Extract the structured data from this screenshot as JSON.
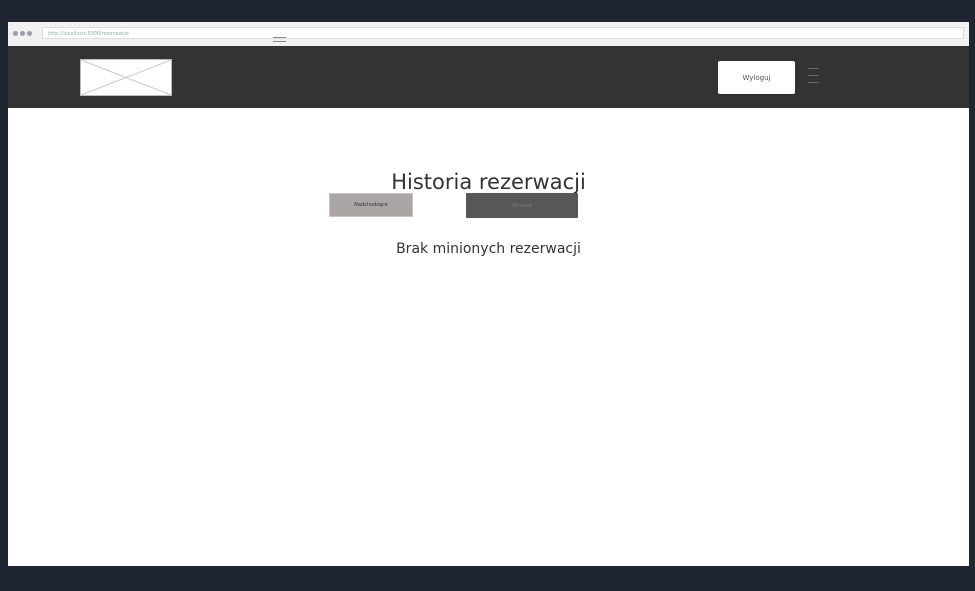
{
  "browser": {
    "url": "http://localhost:5000/rezerwacje"
  },
  "header": {
    "logout_label": "Wyloguj"
  },
  "main": {
    "title": "Historia rezerwacji",
    "tabs": [
      {
        "label": "Nadchodzące",
        "active": false
      },
      {
        "label": "Minione",
        "active": true
      }
    ],
    "empty_message": "Brak minionych rezerwacji"
  },
  "colors": {
    "background_frame": "#1f2632",
    "top_bar": "#333333",
    "tab_upcoming": "#aba5a6",
    "tab_past": "#575757"
  },
  "icons": [
    "logo-placeholder-icon",
    "hamburger-menu-icon"
  ]
}
